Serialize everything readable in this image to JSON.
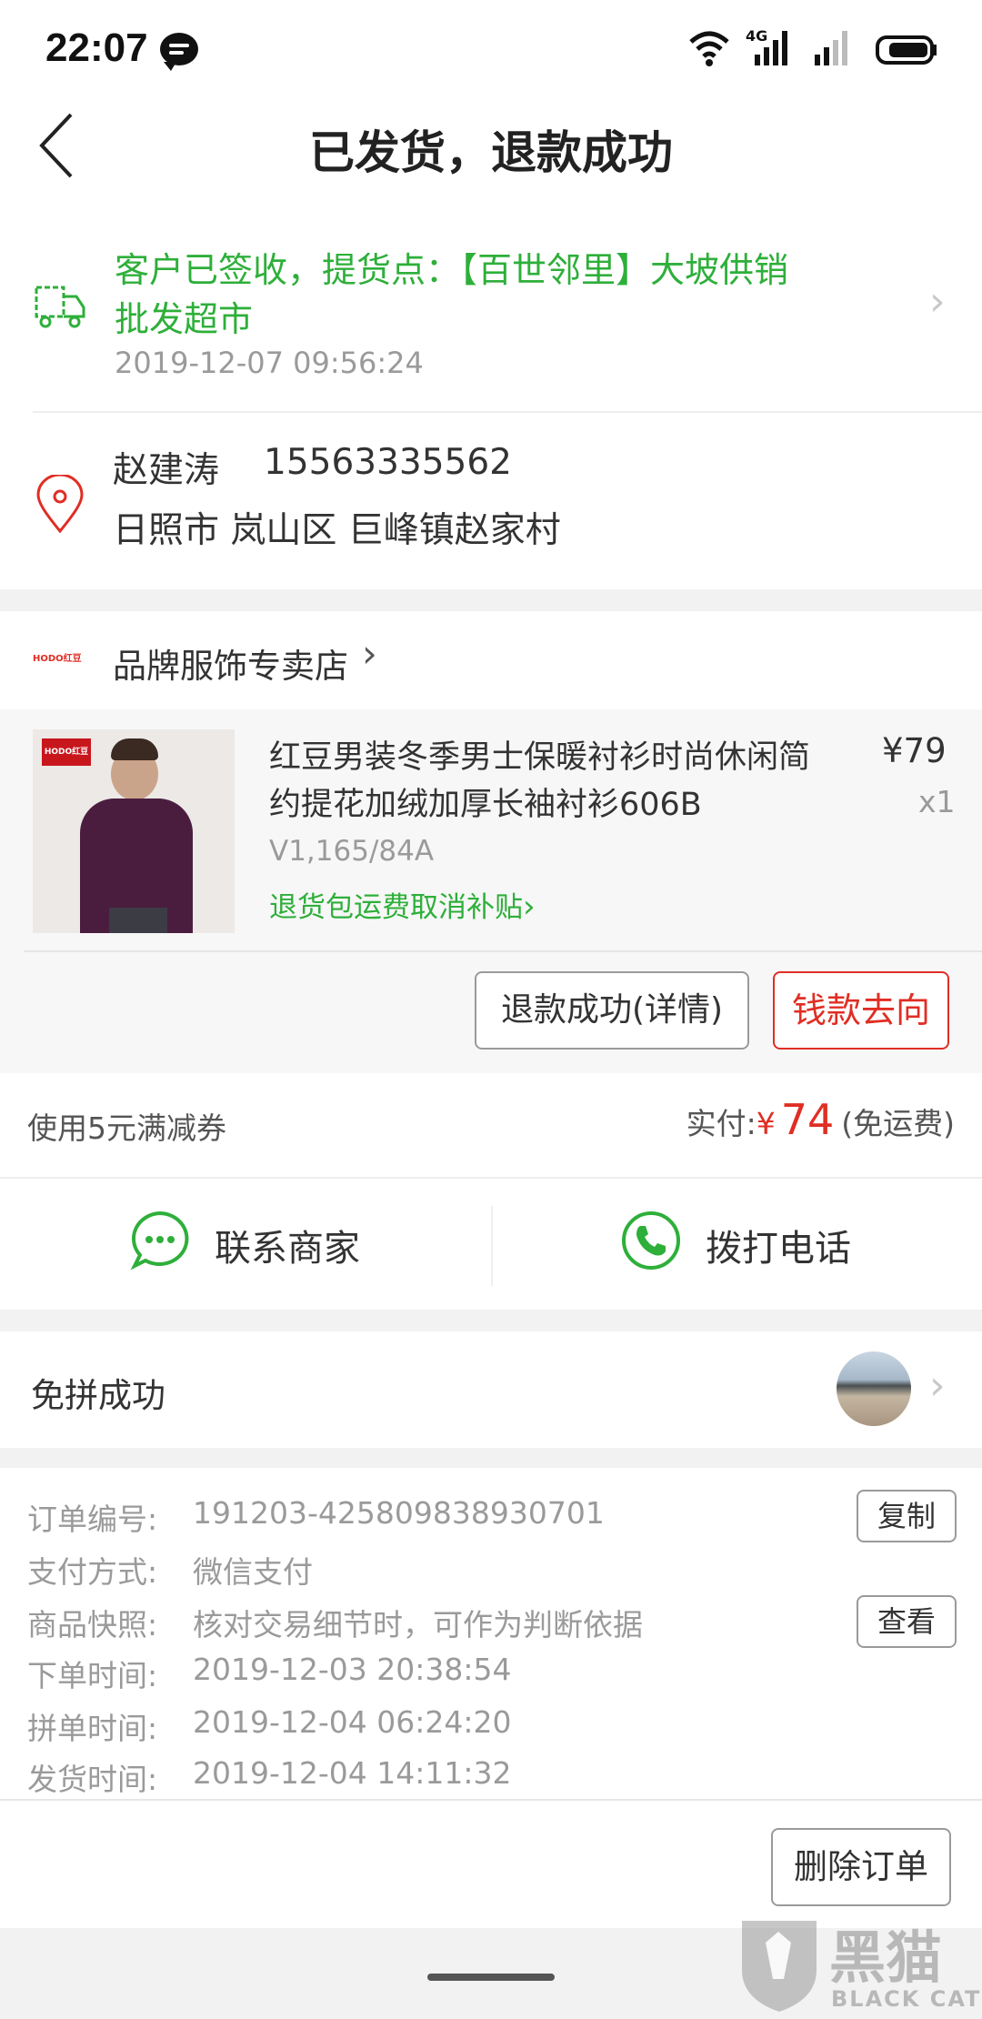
{
  "status_bar": {
    "time": "22:07",
    "network": "4G"
  },
  "header": {
    "title": "已发货，退款成功"
  },
  "logistics": {
    "status_line1": "客户已签收，提货点：【百世邻里】大坡供销",
    "status_line2": "批发超市",
    "timestamp": "2019-12-07 09:56:24"
  },
  "address": {
    "name": "赵建涛",
    "phone": "15563335562",
    "location": "日照市 岚山区 巨峰镇赵家村"
  },
  "store": {
    "logo_text": "HODO红豆",
    "name": "品牌服饰专卖店"
  },
  "product": {
    "image_badge": "HODO红豆",
    "title_line1": "红豆男装冬季男士保暖衬衫时尚休闲简",
    "title_line2": "约提花加绒加厚长袖衬衫606B",
    "price": "¥79",
    "quantity": "x1",
    "spec": "V1,165/84A",
    "shipping_note": "退货包运费取消补贴"
  },
  "actions": {
    "refund_detail": "退款成功(详情)",
    "money_flow": "钱款去向"
  },
  "payment": {
    "coupon": "使用5元满减券",
    "paid_label": "实付:",
    "currency": "¥",
    "amount": "74",
    "shipping": "(免运费)"
  },
  "contact": {
    "merchant": "联系商家",
    "call": "拨打电话"
  },
  "group": {
    "status": "免拼成功"
  },
  "order_info": {
    "rows": [
      {
        "label": "订单编号:",
        "value": "191203-425809838930701"
      },
      {
        "label": "支付方式:",
        "value": "微信支付"
      },
      {
        "label": "商品快照:",
        "value": "核对交易细节时，可作为判断依据"
      },
      {
        "label": "下单时间:",
        "value": "2019-12-03 20:38:54"
      },
      {
        "label": "拼单时间:",
        "value": "2019-12-04 06:24:20"
      },
      {
        "label": "发货时间:",
        "value": "2019-12-04 14:11:32"
      }
    ],
    "copy_label": "复制",
    "view_label": "查看"
  },
  "footer": {
    "delete_order": "删除订单"
  },
  "watermark": {
    "text": "黑猫",
    "sub": "BLACK CAT"
  },
  "colors": {
    "green": "#2eaf3a",
    "red": "#e02e24",
    "gray": "#9a9a9a"
  }
}
